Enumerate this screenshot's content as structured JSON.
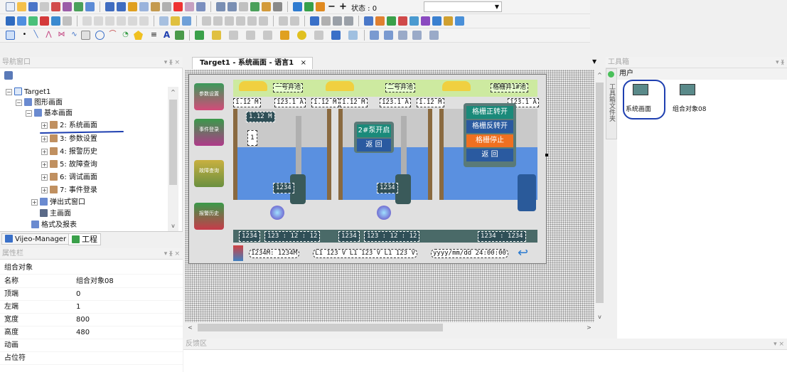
{
  "toolbar": {
    "status_label": "状态 : 0",
    "combo_value": ""
  },
  "nav_panel": {
    "title": "导航窗口",
    "tree": [
      {
        "label": "Target1"
      },
      {
        "label": "图形画面"
      },
      {
        "label": "基本画面"
      },
      {
        "label": "2: 系统画面"
      },
      {
        "label": "3: 参数设置"
      },
      {
        "label": "4: 报警历史"
      },
      {
        "label": "5: 故障查询"
      },
      {
        "label": "6: 调试画面"
      },
      {
        "label": "7: 事件登录"
      },
      {
        "label": "弹出式窗口"
      },
      {
        "label": "主画面"
      },
      {
        "label": "格式及报表"
      }
    ],
    "bottom_tabs": [
      "Vijeo-Manager",
      "工程"
    ]
  },
  "props_panel": {
    "title": "属性栏",
    "header": "组合对象",
    "rows": [
      {
        "key": "名称",
        "value": "组合对象08"
      },
      {
        "key": "顶端",
        "value": "0"
      },
      {
        "key": "左端",
        "value": "1"
      },
      {
        "key": "宽度",
        "value": "800"
      },
      {
        "key": "高度",
        "value": "480"
      },
      {
        "key": "动画",
        "value": ""
      },
      {
        "key": "占位符",
        "value": ""
      }
    ]
  },
  "editor": {
    "tab_title": "Target1 - 系统画面 - 语言1",
    "close_glyph": "×"
  },
  "hmi": {
    "banner_labels": [
      "一号井池",
      "二号井池",
      "格栅井1#池"
    ],
    "top_values": [
      "1.12 M",
      "123.1 A",
      "1.12 M",
      "1.12 M",
      "123.1 A",
      "1.12 M",
      "123.1 A"
    ],
    "level_left": "1.12 M",
    "marker_left": "1",
    "pump_value_1": "1234",
    "pump_value_2": "1234",
    "panel_mid": {
      "btn1": "2#泵开启",
      "btn2": "返 回"
    },
    "panel_right": {
      "btn1": "格栅正转开",
      "btn2": "格栅反转开",
      "btn3": "格栅停止",
      "btn4": "返 回"
    },
    "side_books": [
      "参数设置",
      "事件登录",
      "故障查询",
      "报警历史"
    ],
    "bottom_values": [
      "1234",
      "123 : 12 : 12",
      "1234",
      "123 : 12 : 12",
      "1234 : 1234"
    ],
    "status_bar": {
      "level": "1234M: 1234M",
      "voltage": "L1 123 V  L1 123 V  L1 123 V",
      "datetime": "yyyy/mm/dd 24:00:00"
    }
  },
  "toolbox": {
    "title": "工具箱",
    "side_tab": "工具箱文件夹",
    "category": "用户",
    "items": [
      "系统画面",
      "组合对象08"
    ]
  },
  "feedback": {
    "title": "反馈区"
  },
  "colors": {
    "accent_blue": "#1e3fb0",
    "hmi_blue": "#5a90e0",
    "hmi_green": "#d9f5b3"
  }
}
